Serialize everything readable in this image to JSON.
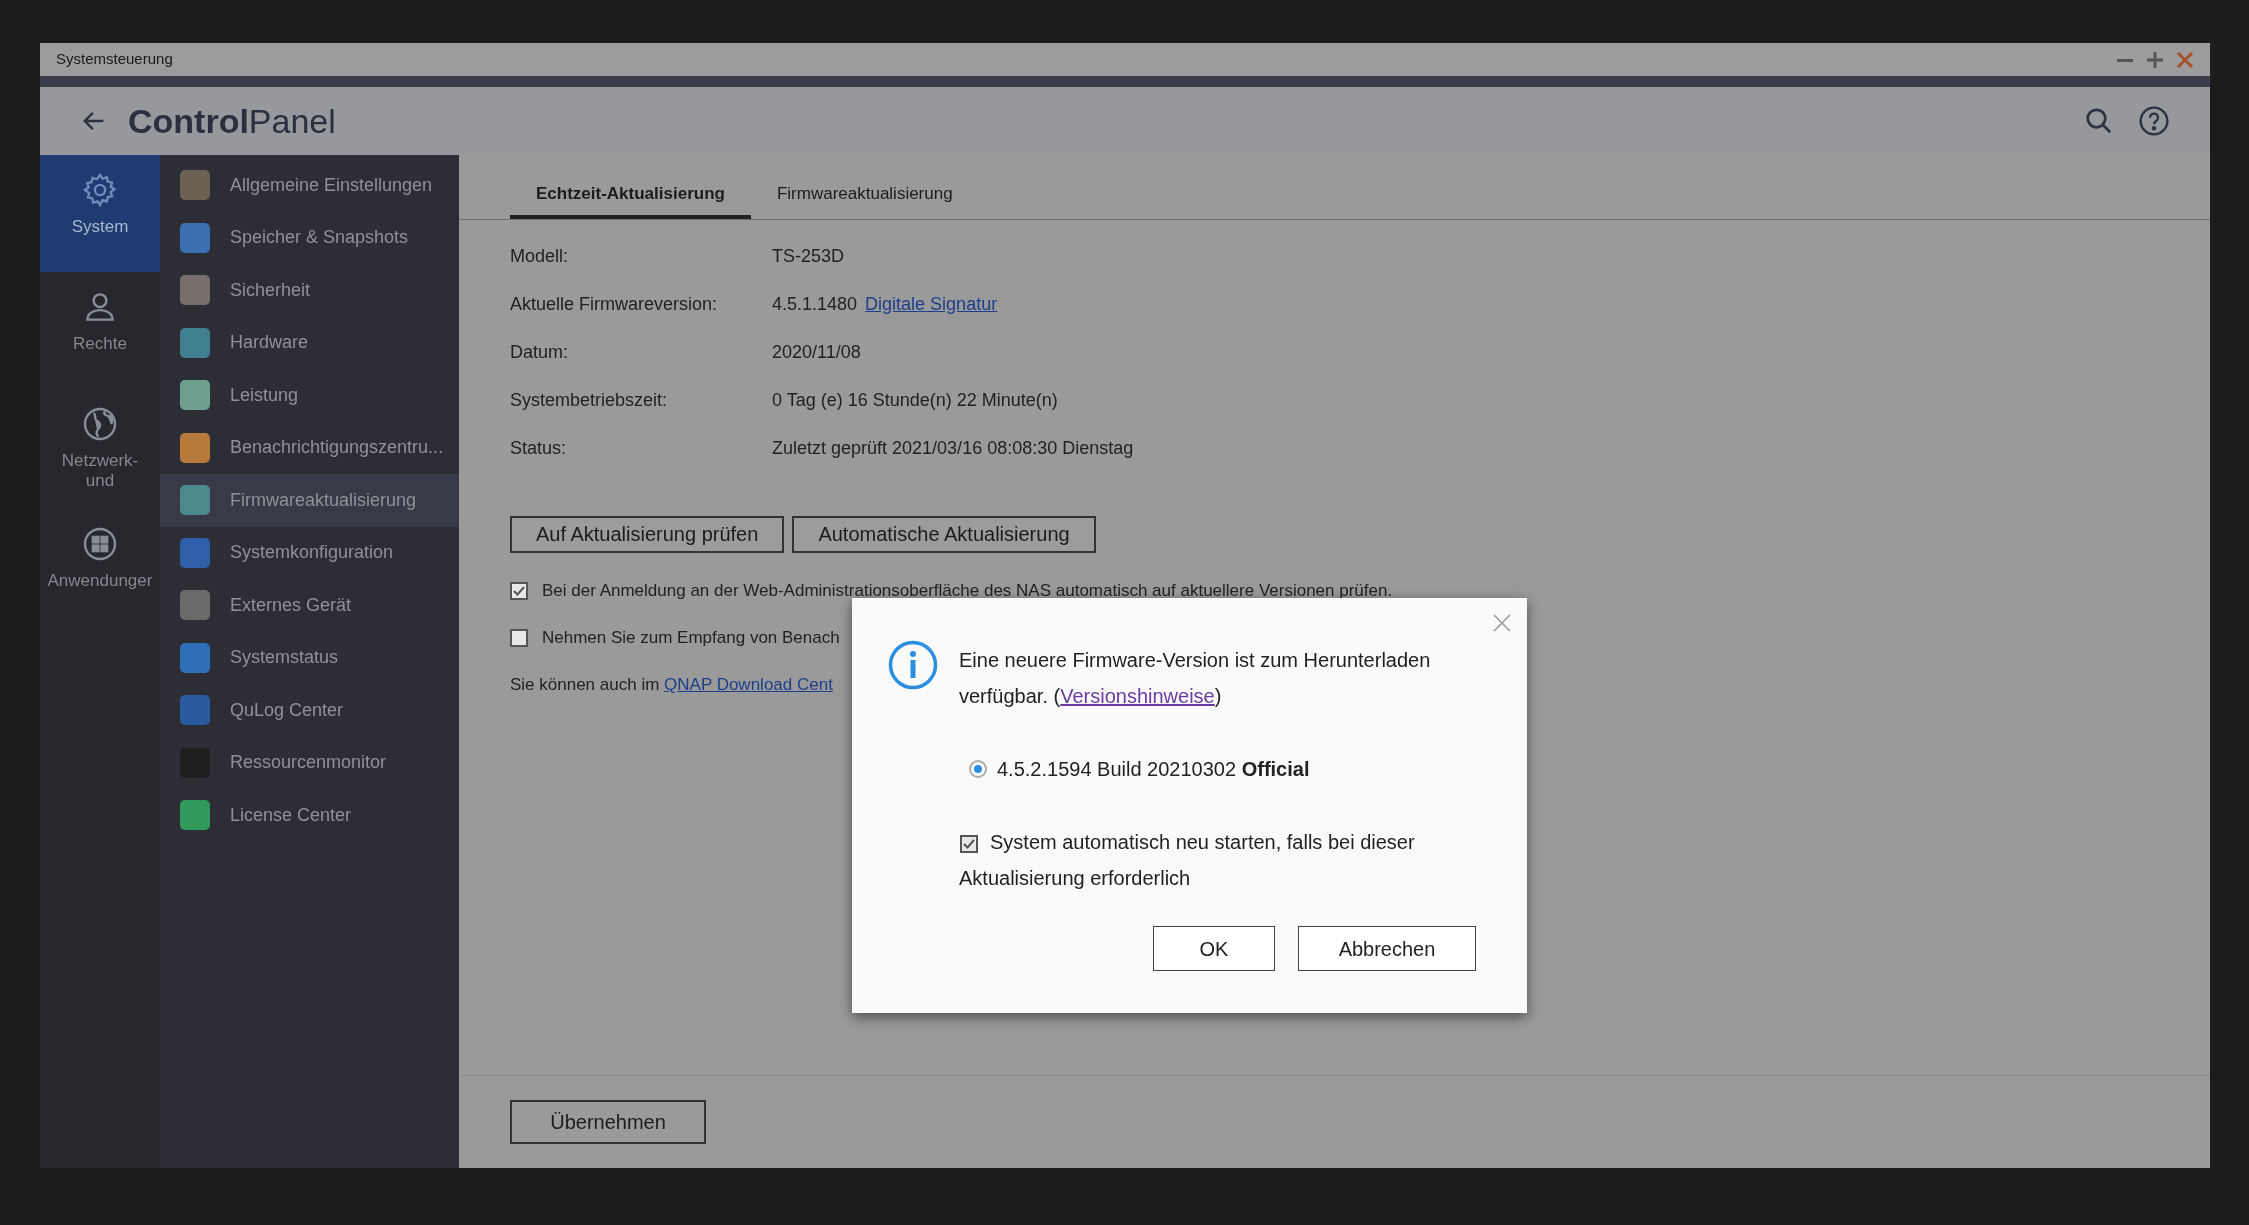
{
  "window": {
    "title": "Systemsteuerung"
  },
  "header": {
    "title": "**Control**Panel"
  },
  "nav_rail": [
    {
      "label": "System",
      "kind": "gear",
      "selected": true
    },
    {
      "label": "Rechte",
      "kind": "user",
      "selected": false
    },
    {
      "label": "Netzwerk-\nund",
      "kind": "globe",
      "selected": false
    },
    {
      "label": "Anwendunger",
      "kind": "apps",
      "selected": false
    }
  ],
  "menu": [
    {
      "label": "Allgemeine Einstellungen",
      "color": "#6b6255",
      "selected": false
    },
    {
      "label": "Speicher & Snapshots",
      "color": "#3a6fb0",
      "selected": false
    },
    {
      "label": "Sicherheit",
      "color": "#77706a",
      "selected": false
    },
    {
      "label": "Hardware",
      "color": "#3f7f8f",
      "selected": false
    },
    {
      "label": "Leistung",
      "color": "#6fa08f",
      "selected": false
    },
    {
      "label": "Benachrichtigungszentru...",
      "color": "#b87a3a",
      "selected": false
    },
    {
      "label": "Firmwareaktualisierung",
      "color": "#4a8a8a",
      "selected": true
    },
    {
      "label": "Systemkonfiguration",
      "color": "#2f5fa8",
      "selected": false
    },
    {
      "label": "Externes Gerät",
      "color": "#6a6a6a",
      "selected": false
    },
    {
      "label": "Systemstatus",
      "color": "#2f6fb8",
      "selected": false
    },
    {
      "label": "QuLog Center",
      "color": "#2a5aa0",
      "selected": false
    },
    {
      "label": "Ressourcenmonitor",
      "color": "#1e1e1e",
      "selected": false
    },
    {
      "label": "License Center",
      "color": "#2f9a5a",
      "selected": false
    }
  ],
  "tabs": [
    {
      "label": "Echtzeit-Aktualisierung",
      "selected": true
    },
    {
      "label": "Firmwareaktualisierung",
      "selected": false
    }
  ],
  "info": [
    {
      "label": "Modell:",
      "value": "TS-253D"
    },
    {
      "label": "Aktuelle Firmwareversion:",
      "value": "4.5.1.1480",
      "link": "Digitale Signatur"
    },
    {
      "label": "Datum:",
      "value": "2020/11/08"
    },
    {
      "label": "Systembetriebszeit:",
      "value": "0 Tag (e) 16 Stunde(n) 22 Minute(n)"
    },
    {
      "label": "Status:",
      "value": "Zuletzt geprüft 2021/03/16 08:08:30 Dienstag"
    }
  ],
  "actions": [
    "Auf Aktualisierung prüfen",
    "Automatische Aktualisierung"
  ],
  "options": [
    {
      "label": "Bei der Anmeldung an der Web-Administrationsoberfläche des NAS automatisch auf aktuellere Versionen prüfen.",
      "checked": true
    },
    {
      "label": "Nehmen Sie zum Empfang von Benach",
      "checked": false
    }
  ],
  "note": {
    "text": "Sie können auch im ",
    "link": "QNAP Download Cent"
  },
  "footer": {
    "apply": "Übernehmen"
  },
  "dialog": {
    "message": "Eine neuere Firmware-Version ist zum Herunterladen verfügbar. (",
    "link": "Versionshinweise",
    "message_end": ")",
    "version": {
      "label": "4.5.2.1594 Build 20210302 **Official**",
      "selected": true
    },
    "restart": {
      "label": "System automatisch neu starten, falls bei dieser Aktualisierung erforderlich",
      "checked": true
    },
    "buttons": [
      "OK",
      "Abbrechen"
    ]
  }
}
